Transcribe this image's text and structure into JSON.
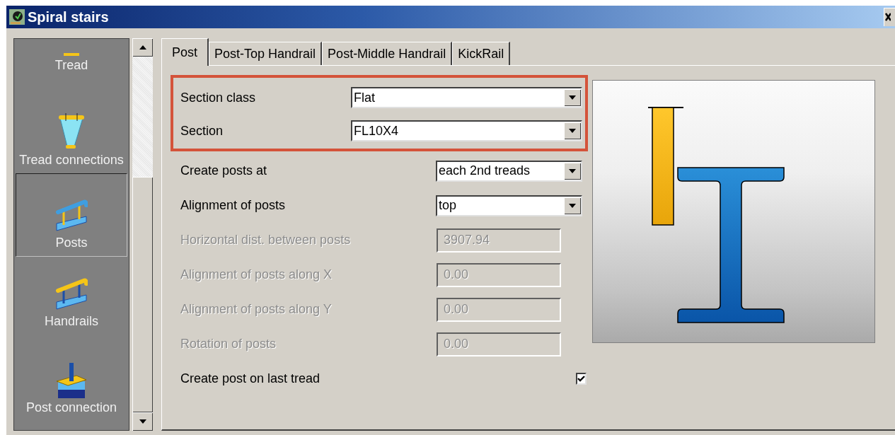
{
  "window": {
    "title": "Spiral stairs"
  },
  "sidebar": {
    "items": [
      {
        "label": "Tread",
        "kind": "tread",
        "selected": false
      },
      {
        "label": "Tread connections",
        "kind": "tread-connection",
        "selected": false
      },
      {
        "label": "Posts",
        "kind": "posts",
        "selected": true
      },
      {
        "label": "Handrails",
        "kind": "handrails",
        "selected": false
      },
      {
        "label": "Post connection",
        "kind": "post-connection",
        "selected": false
      }
    ]
  },
  "tabs": [
    {
      "label": "Post",
      "selected": true
    },
    {
      "label": "Post-Top Handrail",
      "selected": false
    },
    {
      "label": "Post-Middle Handrail",
      "selected": false
    },
    {
      "label": "KickRail",
      "selected": false
    }
  ],
  "highlighted_fields": [
    {
      "kind": "dropdown",
      "label": "Section class",
      "value": "Flat",
      "disabled": false
    },
    {
      "kind": "dropdown",
      "label": "Section",
      "value": "FL10X4",
      "disabled": false
    }
  ],
  "fields": [
    {
      "kind": "dropdown",
      "label": "Create posts at",
      "value": "each 2nd treads",
      "disabled": false
    },
    {
      "kind": "dropdown",
      "label": "Alignment of posts",
      "value": "top",
      "disabled": false
    },
    {
      "kind": "text",
      "label": "Horizontal dist. between posts",
      "value": "3907.94",
      "disabled": true
    },
    {
      "kind": "text",
      "label": "Alignment of posts along X",
      "value": "0.00",
      "disabled": true
    },
    {
      "kind": "text",
      "label": "Alignment of posts along Y",
      "value": "0.00",
      "disabled": true
    },
    {
      "kind": "text",
      "label": "Rotation of posts",
      "value": "0.00",
      "disabled": true
    },
    {
      "kind": "checkbox",
      "label": "Create post on last tread",
      "checked": true,
      "disabled": false
    }
  ]
}
